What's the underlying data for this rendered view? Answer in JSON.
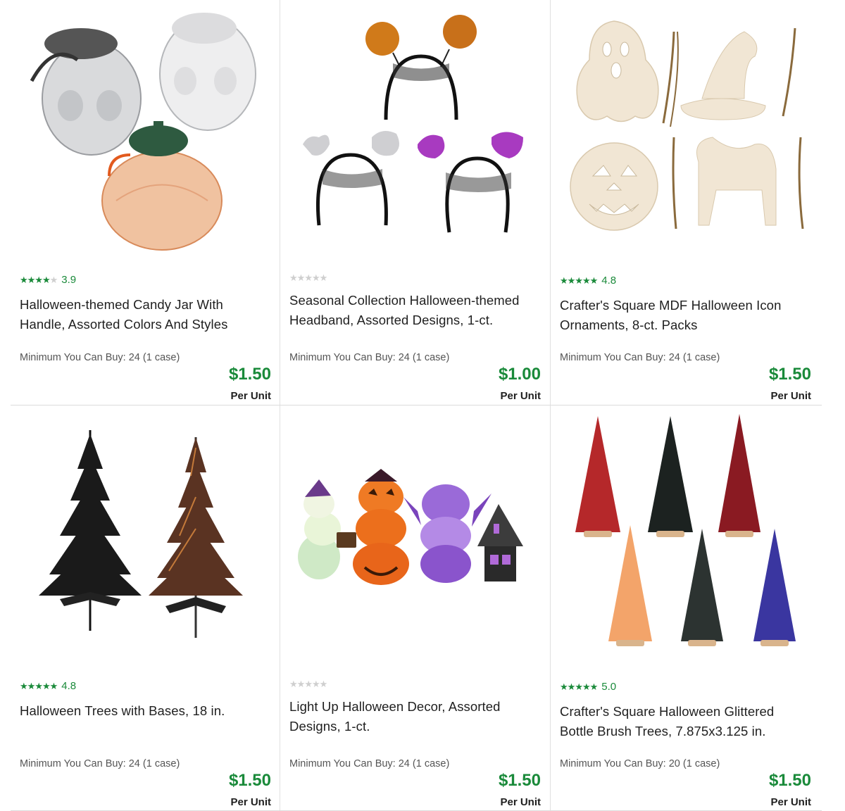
{
  "colors": {
    "accent_green": "#1a8a3a",
    "star_empty": "#cfcfcf",
    "divider": "#dcdcdc"
  },
  "products": [
    {
      "name": "Halloween-themed Candy Jar With Handle, Assorted Colors And Styles",
      "title_lines": [
        "Halloween-themed Candy Jar With",
        "Handle, Assorted Colors And Styles"
      ],
      "rating": "3.9",
      "stars_filled": 4,
      "minimum": "Minimum You Can Buy: 24 (1 case)",
      "price": "$1.50",
      "per_unit": "Per Unit",
      "image": "candy-jars-image"
    },
    {
      "name": "Seasonal Collection Halloween-themed Headband, Assorted Designs, 1-ct.",
      "title_lines": [
        "Seasonal Collection Halloween-themed",
        "Headband, Assorted Designs, 1-ct."
      ],
      "rating": "",
      "stars_filled": 0,
      "minimum": "Minimum You Can Buy: 24 (1 case)",
      "price": "$1.00",
      "per_unit": "Per Unit",
      "image": "headbands-image"
    },
    {
      "name": "Crafter's Square MDF Halloween Icon Ornaments, 8-ct. Packs",
      "title_lines": [
        "Crafter's Square MDF Halloween Icon",
        "Ornaments, 8-ct. Packs"
      ],
      "rating": "4.8",
      "stars_filled": 5,
      "minimum": "Minimum You Can Buy: 24 (1 case)",
      "price": "$1.50",
      "per_unit": "Per Unit",
      "image": "wood-ornaments-image"
    },
    {
      "name": "Halloween Trees with Bases, 18 in.",
      "title_lines": [
        "Halloween Trees with Bases, 18 in.",
        ""
      ],
      "rating": "4.8",
      "stars_filled": 5,
      "minimum": "Minimum You Can Buy: 24 (1 case)",
      "price": "$1.50",
      "per_unit": "Per Unit",
      "image": "halloween-trees-image"
    },
    {
      "name": "Light Up Halloween Decor, Assorted Designs, 1-ct.",
      "title_lines": [
        "Light Up Halloween Decor, Assorted",
        "Designs, 1-ct."
      ],
      "rating": "",
      "stars_filled": 0,
      "minimum": "Minimum You Can Buy: 24 (1 case)",
      "price": "$1.50",
      "per_unit": "Per Unit",
      "image": "light-up-decor-image"
    },
    {
      "name": "Crafter's Square Halloween Glittered Bottle Brush Trees, 7.875x3.125 in.",
      "title_lines": [
        "Crafter's Square Halloween Glittered",
        "Bottle Brush Trees, 7.875x3.125 in."
      ],
      "rating": "5.0",
      "stars_filled": 5,
      "minimum": "Minimum You Can Buy: 20 (1 case)",
      "price": "$1.50",
      "per_unit": "Per Unit",
      "image": "bottle-brush-trees-image"
    }
  ]
}
